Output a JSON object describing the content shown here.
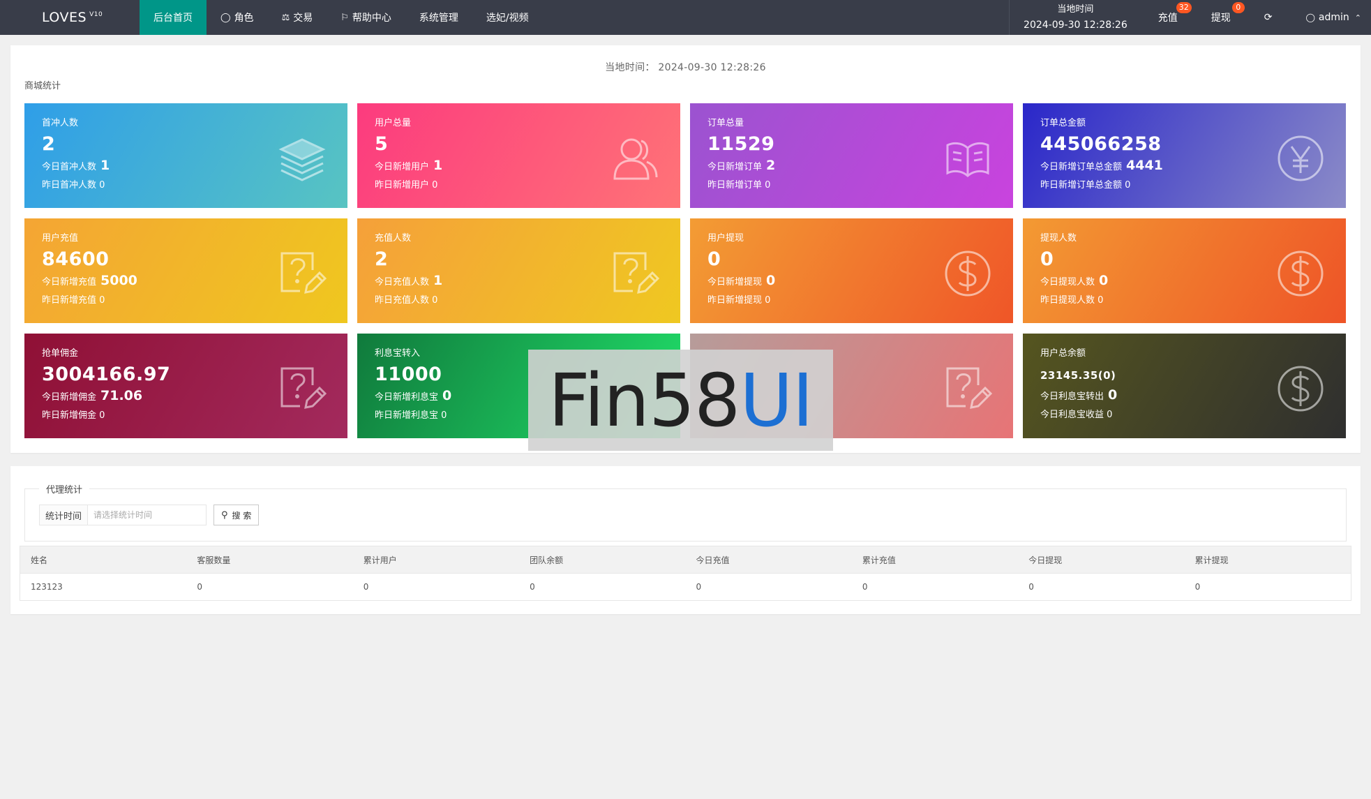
{
  "topbar": {
    "logo": "LOVES",
    "logo_version": "V10",
    "nav": [
      {
        "label": "后台首页",
        "icon": "",
        "active": true
      },
      {
        "label": "角色",
        "icon": "user-icon",
        "active": false
      },
      {
        "label": "交易",
        "icon": "scale-icon",
        "active": false
      },
      {
        "label": "帮助中心",
        "icon": "flag-icon",
        "active": false
      },
      {
        "label": "系统管理",
        "icon": "",
        "active": false
      },
      {
        "label": "选妃/视频",
        "icon": "",
        "active": false
      }
    ],
    "time_label": "当地时间",
    "time_value": "2024-09-30 12:28:26",
    "recharge_label": "充值",
    "recharge_badge": "32",
    "withdraw_label": "提现",
    "withdraw_badge": "0",
    "refresh_icon": "refresh-icon",
    "user_label": "admin"
  },
  "stats": {
    "local_time": "当地时间：  2024-09-30 12:28:26",
    "section_title": "商城统计",
    "cards": [
      {
        "title": "首冲人数",
        "value": "2",
        "today_label": "今日首冲人数",
        "today_value": "1",
        "yesterday": "昨日首冲人数 0",
        "icon": "layers-icon"
      },
      {
        "title": "用户总量",
        "value": "5",
        "today_label": "今日新增用户",
        "today_value": "1",
        "yesterday": "昨日新增用户 0",
        "icon": "users-icon"
      },
      {
        "title": "订单总量",
        "value": "11529",
        "today_label": "今日新增订单",
        "today_value": "2",
        "yesterday": "昨日新增订单 0",
        "icon": "book-icon"
      },
      {
        "title": "订单总金额",
        "value": "445066258",
        "today_label": "今日新增订单总金额",
        "today_value": "4441",
        "yesterday": "昨日新增订单总金额 0",
        "icon": "yen-icon"
      },
      {
        "title": "用户充值",
        "value": "84600",
        "today_label": "今日新增充值",
        "today_value": "5000",
        "yesterday": "昨日新增充值 0",
        "icon": "question-edit-icon"
      },
      {
        "title": "充值人数",
        "value": "2",
        "today_label": "今日充值人数",
        "today_value": "1",
        "yesterday": "昨日充值人数 0",
        "icon": "question-edit-icon"
      },
      {
        "title": "用户提现",
        "value": "0",
        "today_label": "今日新增提现",
        "today_value": "0",
        "yesterday": "昨日新增提现 0",
        "icon": "dollar-icon"
      },
      {
        "title": "提现人数",
        "value": "0",
        "today_label": "今日提现人数",
        "today_value": "0",
        "yesterday": "昨日提现人数 0",
        "icon": "dollar-icon"
      },
      {
        "title": "抢单佣金",
        "value": "3004166.97",
        "today_label": "今日新增佣金",
        "today_value": "71.06",
        "yesterday": "昨日新增佣金 0",
        "icon": "question-edit-icon"
      },
      {
        "title": "利息宝转入",
        "value": "11000",
        "today_label": "今日新增利息宝",
        "today_value": "0",
        "yesterday": "昨日新增利息宝 0",
        "icon": ""
      },
      {
        "title": "",
        "value": "",
        "today_label": "",
        "today_value": "",
        "yesterday": "",
        "icon": "question-edit-icon"
      },
      {
        "title": "用户总余额",
        "value": "23145.35(0)",
        "today_label": "今日利息宝转出",
        "today_value": "0",
        "yesterday": "今日利息宝收益 0",
        "icon": "dollar-icon"
      }
    ]
  },
  "watermark": {
    "dark": "Fin58",
    "blue": "UI"
  },
  "agent": {
    "legend": "代理统计",
    "filter_label": "统计时间",
    "filter_placeholder": "请选择统计时间",
    "search_label": "搜 索",
    "columns": [
      "姓名",
      "客服数量",
      "累计用户",
      "团队余额",
      "今日充值",
      "累计充值",
      "今日提现",
      "累计提现"
    ],
    "rows": [
      [
        "123123",
        "0",
        "0",
        "0",
        "0",
        "0",
        "0",
        "0"
      ]
    ]
  },
  "colors": {
    "topbar": "#393d49",
    "active_nav": "#009688",
    "badge": "#ff5722"
  }
}
